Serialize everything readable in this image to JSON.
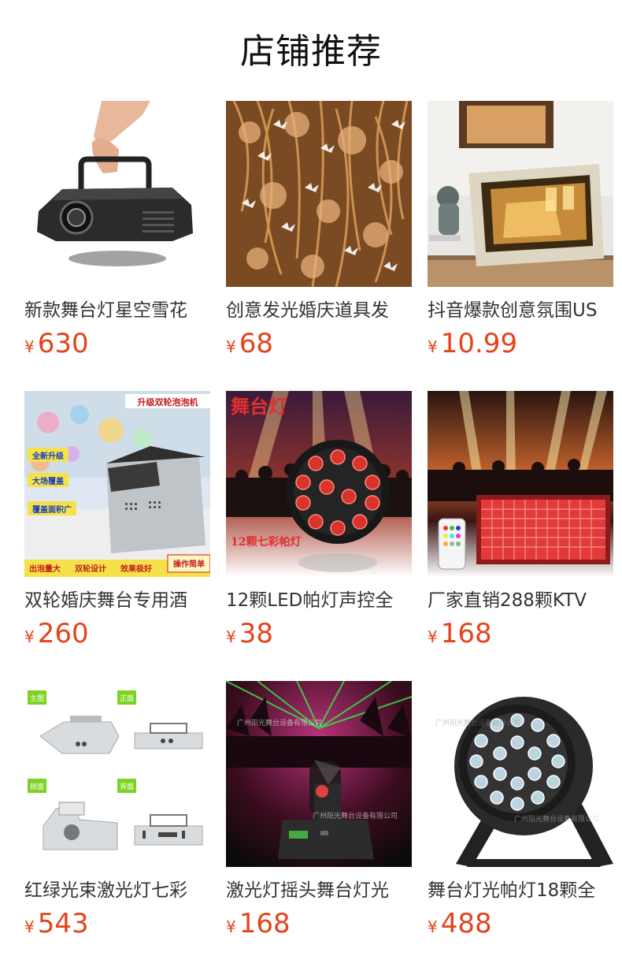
{
  "section": {
    "title": "店铺推荐"
  },
  "colors": {
    "price": "#e4431b",
    "title": "#111111",
    "name": "#333333"
  },
  "currency_symbol": "¥",
  "products": [
    {
      "name": "新款舞台灯星空雪花",
      "price": "630",
      "image_icon": "laser-projector-photo"
    },
    {
      "name": "创意发光婚庆道具发",
      "price": "68",
      "image_icon": "butterfly-string-lights-photo"
    },
    {
      "name": "抖音爆款创意氛围US",
      "price": "10.99",
      "image_icon": "lit-picture-frame-photo"
    },
    {
      "name": "双轮婚庆舞台专用酒",
      "price": "260",
      "image_icon": "bubble-machine-photo",
      "overlay_texts": [
        "升级双轮泡泡机",
        "全新升级",
        "大场覆盖",
        "覆盖面积广",
        "出泡量大",
        "双轮设计",
        "效果极好",
        "操作简单"
      ]
    },
    {
      "name": "12颗LED帕灯声控全",
      "price": "38",
      "image_icon": "led-par-light-photo",
      "overlay_texts": [
        "舞台灯",
        "12颗七彩帕灯"
      ]
    },
    {
      "name": "厂家直销288颗KTV",
      "price": "168",
      "image_icon": "led-strobe-panel-photo"
    },
    {
      "name": "红绿光束激光灯七彩",
      "price": "543",
      "image_icon": "laser-light-views-photo",
      "overlay_texts": [
        "主图",
        "正面",
        "侧面",
        "背面"
      ]
    },
    {
      "name": "激光灯摇头舞台灯光",
      "price": "168",
      "image_icon": "moving-head-laser-photo"
    },
    {
      "name": "舞台灯光帕灯18颗全",
      "price": "488",
      "image_icon": "par-light-18-led-photo"
    }
  ]
}
